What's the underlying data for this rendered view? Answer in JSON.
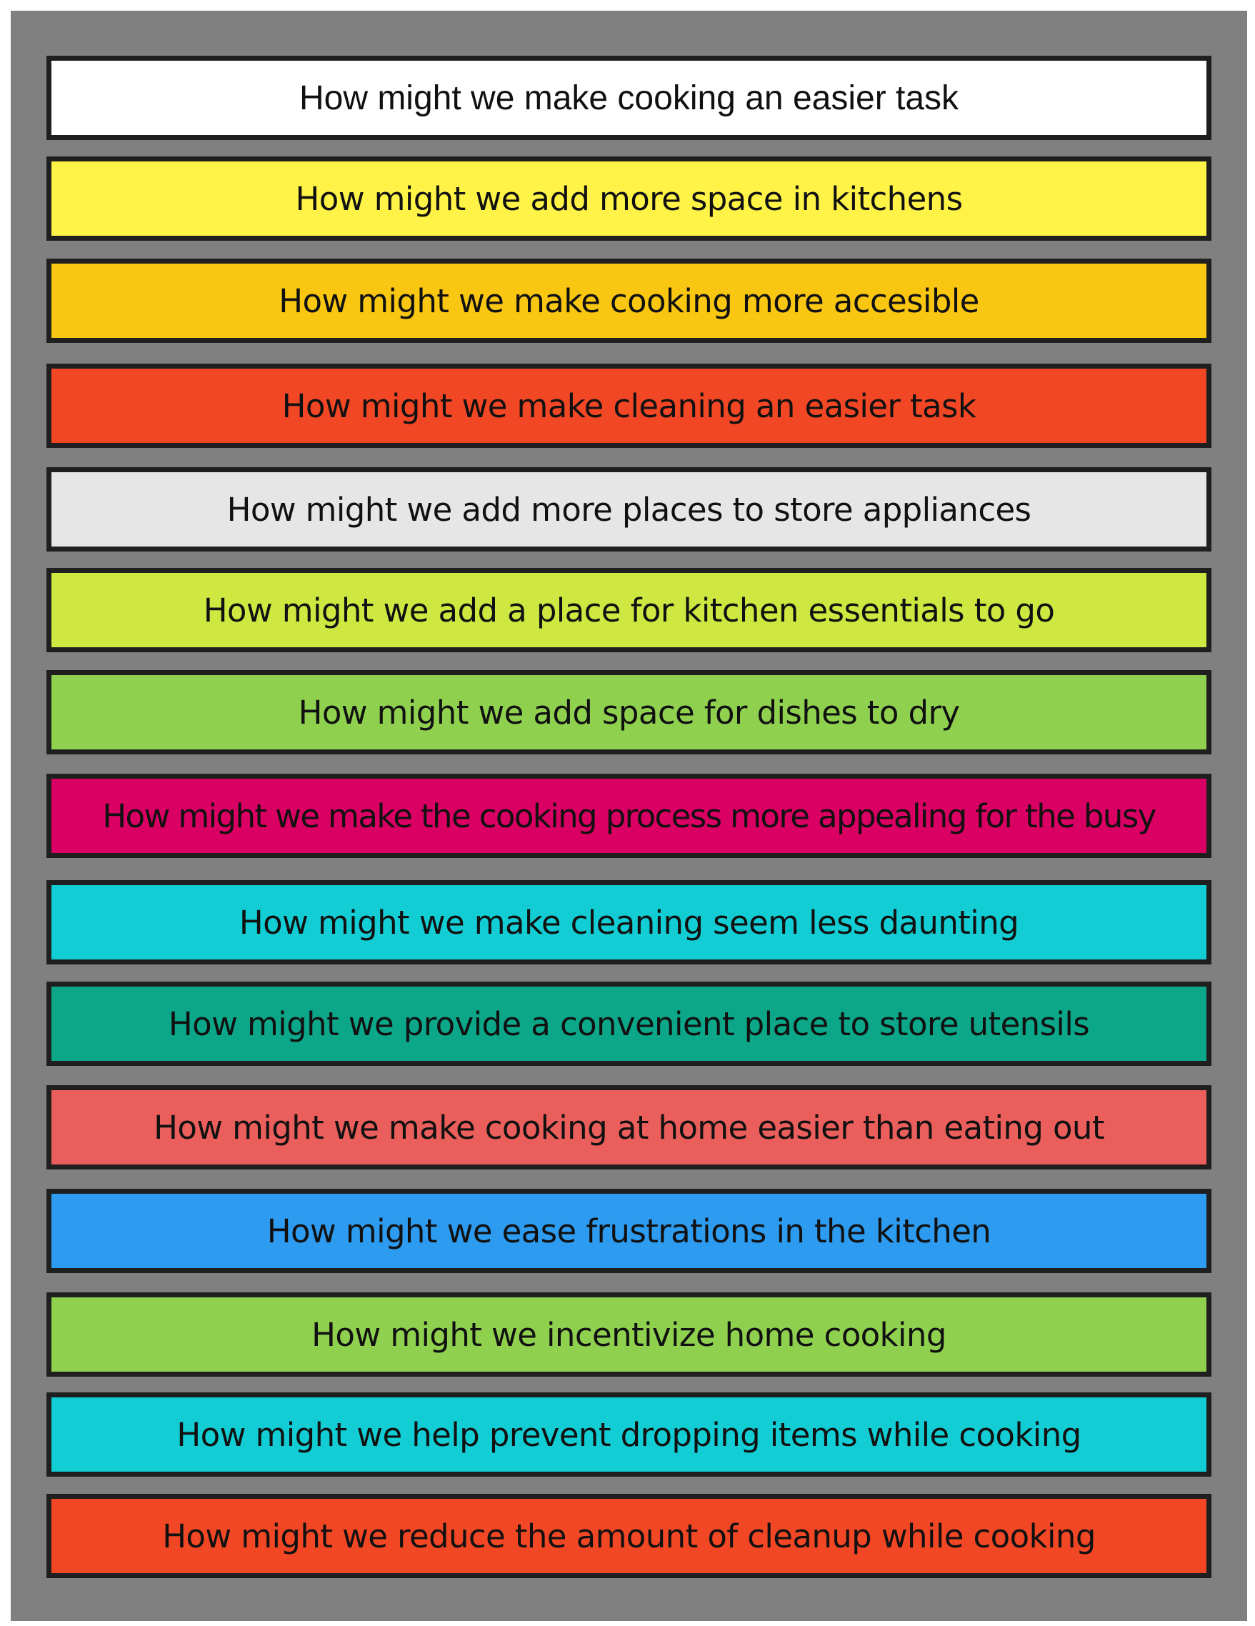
{
  "board": {
    "background": "#808080",
    "cards": [
      {
        "label": "How might we make cooking an easier task",
        "color": "#ffffff"
      },
      {
        "label": "How might we add more space in kitchens",
        "color": "#fef346"
      },
      {
        "label": "How might we make cooking more accesible",
        "color": "#f9c612"
      },
      {
        "label": "How might we make cleaning an easier task",
        "color": "#f24725"
      },
      {
        "label": "How might we add more places to store appliances",
        "color": "#e6e6e6"
      },
      {
        "label": "How might we add a place for kitchen essentials to go",
        "color": "#cee741"
      },
      {
        "label": "How might we add space for dishes to dry",
        "color": "#8fd14f"
      },
      {
        "label": "How might we make the cooking process more appealing for the busy",
        "color": "#da0063"
      },
      {
        "label": "How might we make cleaning seem less daunting",
        "color": "#12cdd4"
      },
      {
        "label": "How might we provide a convenient place to store utensils",
        "color": "#0ca789"
      },
      {
        "label": "How might we make cooking at home easier than eating out",
        "color": "#ea5e5b"
      },
      {
        "label": "How might we ease frustrations in the kitchen",
        "color": "#2d9bf0"
      },
      {
        "label": "How might we incentivize home cooking",
        "color": "#8fd14f"
      },
      {
        "label": "How might we help prevent dropping items while cooking",
        "color": "#12cdd4"
      },
      {
        "label": "How might we reduce the amount of cleanup while cooking",
        "color": "#f24725"
      }
    ]
  }
}
